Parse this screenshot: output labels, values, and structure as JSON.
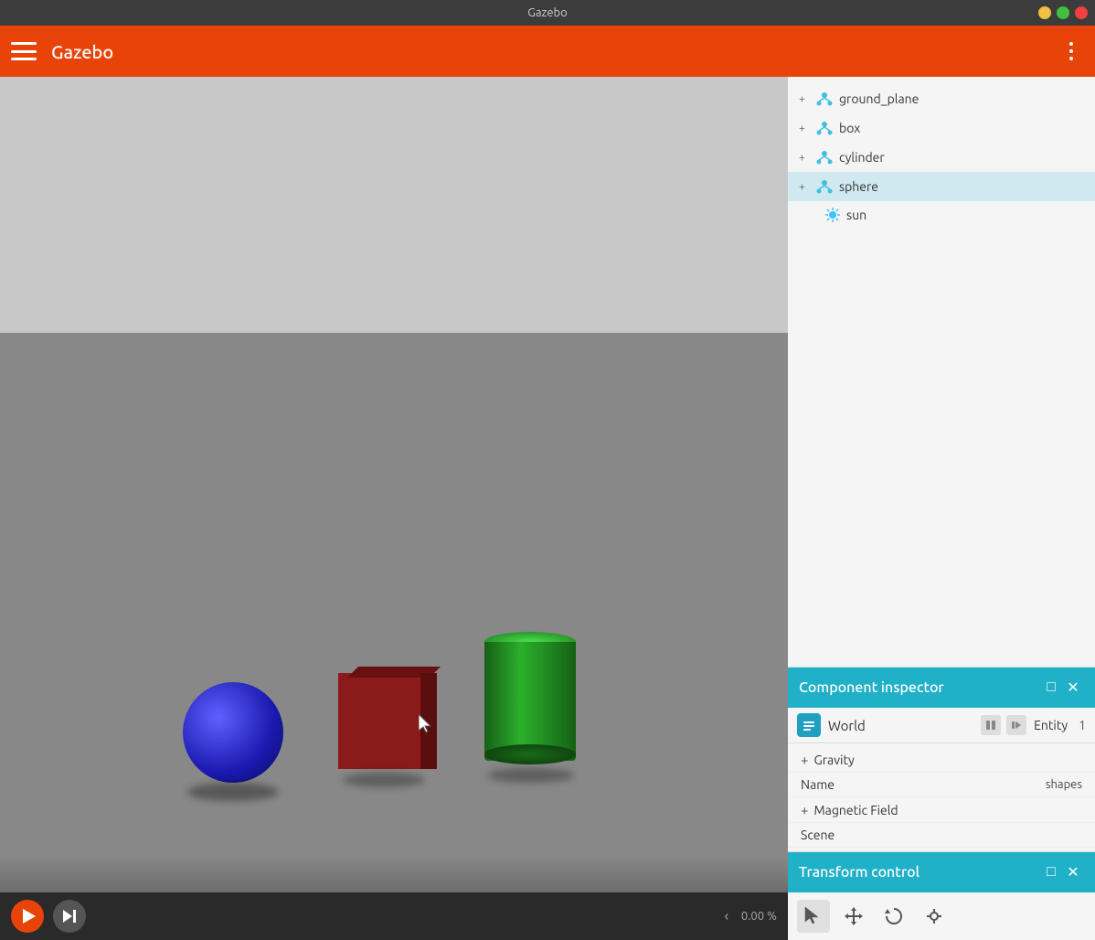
{
  "titlebar": {
    "title": "Gazebo",
    "minimize_label": "minimize",
    "maximize_label": "maximize",
    "close_label": "close"
  },
  "appbar": {
    "title": "Gazebo",
    "hamburger_label": "menu",
    "more_label": "more options"
  },
  "entity_tree": {
    "items": [
      {
        "id": "ground_plane",
        "label": "ground_plane",
        "type": "model",
        "indent": 0
      },
      {
        "id": "box",
        "label": "box",
        "type": "model",
        "indent": 0
      },
      {
        "id": "cylinder",
        "label": "cylinder",
        "type": "model",
        "indent": 0
      },
      {
        "id": "sphere",
        "label": "sphere",
        "type": "model",
        "indent": 0,
        "selected": true
      },
      {
        "id": "sun",
        "label": "sun",
        "type": "light",
        "indent": 1
      }
    ]
  },
  "component_inspector": {
    "title": "Component inspector",
    "world_label": "World",
    "entity_label": "Entity",
    "entity_value": "1",
    "gravity_label": "+ Gravity",
    "name_label": "Name",
    "name_value": "shapes",
    "magnetic_field_label": "+ Magnetic Field",
    "scene_label": "Scene"
  },
  "transform_control": {
    "title": "Transform control",
    "tools": [
      {
        "id": "select",
        "label": "select-tool"
      },
      {
        "id": "translate",
        "label": "translate-tool"
      },
      {
        "id": "rotate",
        "label": "rotate-tool"
      },
      {
        "id": "scale",
        "label": "scale-tool"
      }
    ]
  },
  "viewport": {
    "zoom_label": "0.00 %",
    "play_label": "Play",
    "fast_forward_label": "Fast forward"
  }
}
